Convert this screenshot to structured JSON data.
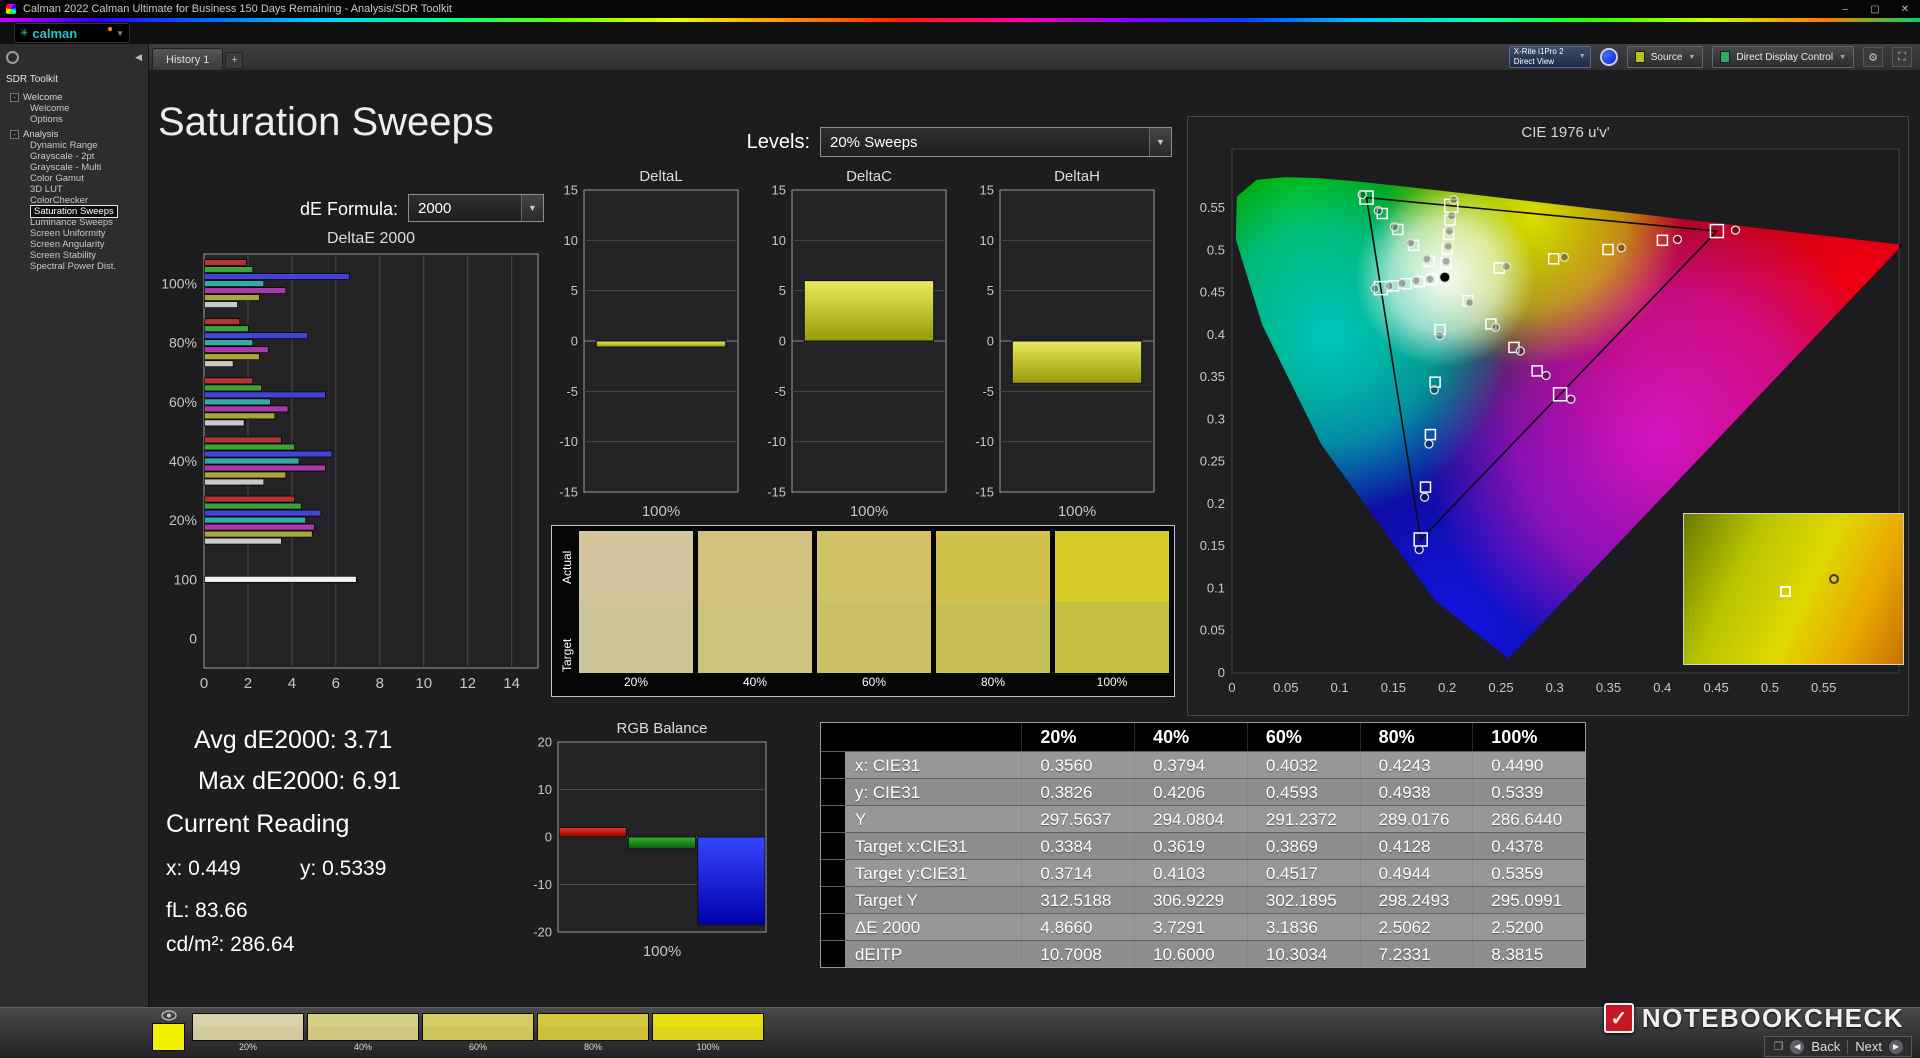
{
  "window": {
    "title": "Calman 2022 Calman Ultimate for Business 150 Days Remaining  - Analysis/SDR Toolkit",
    "minimize": "–",
    "maximize": "▢",
    "close": "✕"
  },
  "logo": {
    "text": "calman",
    "caret": "▼"
  },
  "tabbar": {
    "history_tab": "History 1",
    "add_tab": "+",
    "collapse": "◀"
  },
  "meter": {
    "line1": "X-Rite i1Pro 2",
    "line2": "Direct View"
  },
  "source_button": "Source",
  "display_button": "Direct Display Control",
  "sidebar": {
    "title": "SDR Toolkit",
    "items": [
      {
        "label": "Welcome",
        "level": 0
      },
      {
        "label": "Welcome",
        "level": 1
      },
      {
        "label": "Options",
        "level": 1
      },
      {
        "label": "Analysis",
        "level": 0
      },
      {
        "label": "Dynamic Range",
        "level": 1
      },
      {
        "label": "Grayscale - 2pt",
        "level": 1
      },
      {
        "label": "Grayscale - Multi",
        "level": 1
      },
      {
        "label": "Color Gamut",
        "level": 1
      },
      {
        "label": "3D LUT",
        "level": 1
      },
      {
        "label": "ColorChecker",
        "level": 1
      },
      {
        "label": "Saturation Sweeps",
        "level": 1,
        "selected": true
      },
      {
        "label": "Luminance Sweeps",
        "level": 1
      },
      {
        "label": "Screen Uniformity",
        "level": 1
      },
      {
        "label": "Screen Angularity",
        "level": 1
      },
      {
        "label": "Screen Stability",
        "level": 1
      },
      {
        "label": "Spectral Power Dist.",
        "level": 1
      }
    ]
  },
  "page": {
    "title": "Saturation Sweeps",
    "levels_label": "Levels:",
    "levels_value": "20% Sweeps",
    "de_label": "dE Formula:",
    "de_value": "2000"
  },
  "stats": {
    "avg": "Avg dE2000: 3.71",
    "max": "Max dE2000: 6.91",
    "current_heading": "Current Reading",
    "x": "x: 0.449",
    "y": "y: 0.5339",
    "fl": "fL: 83.66",
    "cd": "cd/m²: 286.64"
  },
  "swatch_panel": {
    "row_labels": [
      "Actual",
      "Target"
    ],
    "levels": [
      "20%",
      "40%",
      "60%",
      "80%",
      "100%"
    ],
    "actual": [
      "#d2c49c",
      "#d2c280",
      "#d2c266",
      "#d0c14b",
      "#d8ca25"
    ],
    "target": [
      "#cdc598",
      "#ccc37f",
      "#cac167",
      "#c5bf55",
      "#c2be3f"
    ]
  },
  "table": {
    "columns": [
      "20%",
      "40%",
      "60%",
      "80%",
      "100%"
    ],
    "rows": [
      {
        "label": "x: CIE31",
        "values": [
          "0.3560",
          "0.3794",
          "0.4032",
          "0.4243",
          "0.4490"
        ]
      },
      {
        "label": "y: CIE31",
        "values": [
          "0.3826",
          "0.4206",
          "0.4593",
          "0.4938",
          "0.5339"
        ]
      },
      {
        "label": "Y",
        "values": [
          "297.5637",
          "294.0804",
          "291.2372",
          "289.0176",
          "286.6440"
        ]
      },
      {
        "label": "Target x:CIE31",
        "values": [
          "0.3384",
          "0.3619",
          "0.3869",
          "0.4128",
          "0.4378"
        ]
      },
      {
        "label": "Target y:CIE31",
        "values": [
          "0.3714",
          "0.4103",
          "0.4517",
          "0.4944",
          "0.5359"
        ]
      },
      {
        "label": "Target Y",
        "values": [
          "312.5188",
          "306.9229",
          "302.1895",
          "298.2493",
          "295.0991"
        ]
      },
      {
        "label": "ΔE 2000",
        "values": [
          "4.8660",
          "3.7291",
          "3.1836",
          "2.5062",
          "2.5200"
        ]
      },
      {
        "label": "dEITP",
        "values": [
          "10.7008",
          "10.6000",
          "10.3034",
          "7.2331",
          "8.3815"
        ]
      }
    ]
  },
  "bottom": {
    "current_patch": "#f4f000",
    "patches": [
      {
        "label": "20%",
        "actual": "#d9d2a8",
        "target": "#d2cb9e"
      },
      {
        "label": "40%",
        "actual": "#d8cf86",
        "target": "#d0c87e"
      },
      {
        "label": "60%",
        "actual": "#d6cc62",
        "target": "#cec45c"
      },
      {
        "label": "80%",
        "actual": "#d4c93e",
        "target": "#cbc13a"
      },
      {
        "label": "100%",
        "actual": "#e8e00e",
        "target": "#ded41a"
      }
    ],
    "back": "Back",
    "next": "Next",
    "watermark": "NOTEBOOKCHECK"
  },
  "chart_data": [
    {
      "id": "deltaE",
      "type": "bar",
      "orientation": "horizontal",
      "title": "DeltaE 2000",
      "xlim": [
        0,
        15.2
      ],
      "xticks": [
        0,
        2,
        4,
        6,
        8,
        10,
        12,
        14
      ],
      "bands": [
        "100%",
        "80%",
        "60%",
        "40%",
        "20%",
        "100",
        "0"
      ],
      "bar_colors": [
        "#b23434",
        "#3aa33a",
        "#4343d6",
        "#36a8a8",
        "#aa39aa",
        "#a8a83a",
        "#c9c9c9"
      ],
      "groups": [
        {
          "band": "100%",
          "values": [
            1.9,
            2.2,
            6.6,
            2.7,
            3.7,
            2.5,
            1.5
          ]
        },
        {
          "band": "80%",
          "values": [
            1.6,
            2.0,
            4.7,
            2.2,
            2.9,
            2.5,
            1.3
          ]
        },
        {
          "band": "60%",
          "values": [
            2.2,
            2.6,
            5.5,
            3.0,
            3.8,
            3.2,
            1.8
          ]
        },
        {
          "band": "40%",
          "values": [
            3.5,
            4.1,
            5.8,
            4.3,
            5.5,
            3.7,
            2.7
          ]
        },
        {
          "band": "20%",
          "values": [
            4.1,
            4.4,
            5.3,
            4.6,
            5.0,
            4.9,
            3.5
          ]
        },
        {
          "band": "100",
          "values": [
            6.91
          ],
          "colors": [
            "#f0f0f0"
          ]
        }
      ]
    },
    {
      "id": "deltaL",
      "type": "bar",
      "title": "DeltaL",
      "ylim": [
        -15,
        15
      ],
      "yticks": [
        15,
        10,
        5,
        0,
        -5,
        -10,
        -15
      ],
      "series": [
        {
          "name": "DeltaL",
          "value": -0.6,
          "color": "yellow"
        }
      ],
      "xlabel": "100%"
    },
    {
      "id": "deltaC",
      "type": "bar",
      "title": "DeltaC",
      "ylim": [
        -15,
        15
      ],
      "yticks": [
        15,
        10,
        5,
        0,
        -5,
        -10,
        -15
      ],
      "series": [
        {
          "name": "DeltaC",
          "value": 6.0,
          "color": "yellow"
        }
      ],
      "xlabel": "100%"
    },
    {
      "id": "deltaH",
      "type": "bar",
      "title": "DeltaH",
      "ylim": [
        -15,
        15
      ],
      "yticks": [
        15,
        10,
        5,
        0,
        -5,
        -10,
        -15
      ],
      "series": [
        {
          "name": "DeltaH",
          "value": -4.2,
          "color": "yellow"
        }
      ],
      "xlabel": "100%"
    },
    {
      "id": "rgb",
      "type": "bar",
      "title": "RGB Balance",
      "ylim": [
        -20,
        20
      ],
      "yticks": [
        20,
        10,
        0,
        -10,
        -20
      ],
      "series": [
        {
          "name": "Red",
          "value": 2.0,
          "color": "red"
        },
        {
          "name": "Green",
          "value": -2.5,
          "color": "green"
        },
        {
          "name": "Blue",
          "value": -18.5,
          "color": "blue"
        }
      ],
      "xlabel": "100%"
    },
    {
      "id": "cie",
      "type": "scatter",
      "title": "CIE 1976 u'v'",
      "xlim": [
        0,
        0.62
      ],
      "ylim": [
        0,
        0.62
      ],
      "ticks": [
        0,
        0.05,
        0.1,
        0.15,
        0.2,
        0.25,
        0.3,
        0.35,
        0.4,
        0.45,
        0.5,
        0.55
      ],
      "white_point": [
        0.1978,
        0.4683
      ],
      "gamut_triangle": [
        [
          0.4507,
          0.5229
        ],
        [
          0.125,
          0.5625
        ],
        [
          0.1754,
          0.1579
        ]
      ],
      "locus": [
        [
          0.6234,
          0.5065
        ],
        [
          0.5203,
          0.5219
        ],
        [
          0.4691,
          0.5296
        ],
        [
          0.4035,
          0.5393
        ],
        [
          0.3315,
          0.5501
        ],
        [
          0.2623,
          0.5604
        ],
        [
          0.2026,
          0.5694
        ],
        [
          0.1531,
          0.5766
        ],
        [
          0.1127,
          0.5821
        ],
        [
          0.0792,
          0.5856
        ],
        [
          0.05,
          0.5867
        ],
        [
          0.0231,
          0.5837
        ],
        [
          0.0046,
          0.5639
        ],
        [
          0.0035,
          0.5131
        ],
        [
          0.0282,
          0.4117
        ],
        [
          0.0828,
          0.2708
        ],
        [
          0.1877,
          0.0871
        ],
        [
          0.2569,
          0.0169
        ]
      ],
      "sweeps": [
        {
          "name": "red",
          "targets": [
            [
              0.2484,
              0.4792
            ],
            [
              0.299,
              0.4901
            ],
            [
              0.3495,
              0.5011
            ],
            [
              0.4001,
              0.512
            ],
            [
              0.4507,
              0.5229
            ]
          ],
          "measured": [
            [
              0.255,
              0.481
            ],
            [
              0.309,
              0.492
            ],
            [
              0.362,
              0.503
            ],
            [
              0.414,
              0.513
            ],
            [
              0.468,
              0.524
            ]
          ]
        },
        {
          "name": "green",
          "targets": [
            [
              0.1832,
              0.4871
            ],
            [
              0.1687,
              0.506
            ],
            [
              0.1541,
              0.5248
            ],
            [
              0.1396,
              0.5437
            ],
            [
              0.125,
              0.5625
            ]
          ],
          "measured": [
            [
              0.181,
              0.49
            ],
            [
              0.166,
              0.509
            ],
            [
              0.151,
              0.528
            ],
            [
              0.136,
              0.547
            ],
            [
              0.121,
              0.566
            ]
          ]
        },
        {
          "name": "blue",
          "targets": [
            [
              0.1933,
              0.4062
            ],
            [
              0.1888,
              0.3441
            ],
            [
              0.1844,
              0.2821
            ],
            [
              0.1799,
              0.22
            ],
            [
              0.1754,
              0.1579
            ]
          ],
          "measured": [
            [
              0.193,
              0.399
            ],
            [
              0.188,
              0.335
            ],
            [
              0.183,
              0.271
            ],
            [
              0.179,
              0.208
            ],
            [
              0.174,
              0.146
            ]
          ]
        },
        {
          "name": "cyan",
          "targets": [
            [
              0.1859,
              0.4657
            ],
            [
              0.174,
              0.4631
            ],
            [
              0.1621,
              0.4606
            ],
            [
              0.1502,
              0.458
            ],
            [
              0.1383,
              0.4554
            ]
          ],
          "measured": [
            [
              0.184,
              0.466
            ],
            [
              0.171,
              0.464
            ],
            [
              0.158,
              0.461
            ],
            [
              0.146,
              0.458
            ],
            [
              0.133,
              0.455
            ]
          ]
        },
        {
          "name": "magenta",
          "targets": [
            [
              0.2192,
              0.4406
            ],
            [
              0.2407,
              0.4129
            ],
            [
              0.2621,
              0.3852
            ],
            [
              0.2836,
              0.3575
            ],
            [
              0.305,
              0.3298
            ]
          ],
          "measured": [
            [
              0.221,
              0.438
            ],
            [
              0.245,
              0.409
            ],
            [
              0.268,
              0.381
            ],
            [
              0.292,
              0.352
            ],
            [
              0.315,
              0.324
            ]
          ]
        },
        {
          "name": "yellow",
          "targets": [
            [
              0.199,
              0.4852
            ],
            [
              0.2002,
              0.5021
            ],
            [
              0.2014,
              0.519
            ],
            [
              0.2026,
              0.5359
            ],
            [
              0.2038,
              0.5528
            ]
          ],
          "measured": [
            [
              0.199,
              0.487
            ],
            [
              0.201,
              0.505
            ],
            [
              0.202,
              0.523
            ],
            [
              0.204,
              0.541
            ],
            [
              0.206,
              0.56
            ]
          ]
        }
      ]
    }
  ]
}
